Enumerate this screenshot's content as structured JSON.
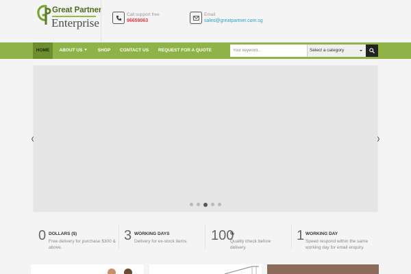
{
  "brand": {
    "name_line1": "Great Partner",
    "name_line2": "Enterprise",
    "colors": {
      "green": "#8fb346",
      "dark_green": "#4f6b20"
    }
  },
  "contact": {
    "phone_label": "Call support free",
    "phone_value": "96659063",
    "phone_icon": "phone-icon",
    "email_label": "Email",
    "email_value": "sales@greatpartner.com.sg",
    "email_icon": "envelope-icon"
  },
  "nav": {
    "items": [
      {
        "label": "HOME"
      },
      {
        "label": "ABOUT US"
      },
      {
        "label": "SHOP"
      },
      {
        "label": "CONTACT US"
      },
      {
        "label": "REQUEST FOR A QUOTE"
      }
    ]
  },
  "search": {
    "placeholder": "Your keyword...",
    "category_selected": "Select a category",
    "button_icon": "search-icon"
  },
  "slider": {
    "dot_count": 5,
    "active_index": 2
  },
  "features": [
    {
      "number": "0",
      "title": "DOLLARS ($)",
      "desc": "Free delivery for purchase $300 & above."
    },
    {
      "number": "3",
      "title": "WORKING DAYS",
      "desc": "Delivery for ex-stock items."
    },
    {
      "number": "100",
      "title": "%",
      "desc": "Quality check before delivery."
    },
    {
      "number": "1",
      "title": "WORKING DAY",
      "desc": "Speed respond within the same working day for email enquiry."
    }
  ]
}
